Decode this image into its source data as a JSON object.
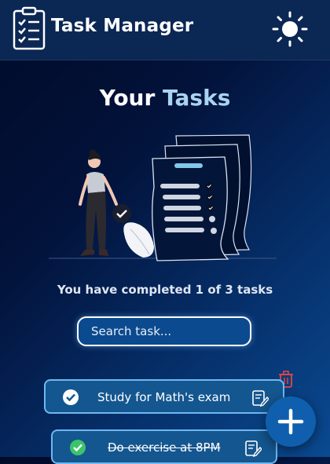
{
  "header": {
    "title": "Task Manager",
    "logo_icon": "checklist-clipboard-icon",
    "theme_toggle_icon": "sun-icon"
  },
  "main": {
    "heading_first": "Your",
    "heading_accent": "Tasks",
    "heading_accent_color": "#a9d4ef",
    "progress_text": "You have completed 1 of 3 tasks",
    "illustration": "woman-checking-checklist-illustration"
  },
  "search": {
    "placeholder": "Search task...",
    "value": ""
  },
  "tasks": [
    {
      "title": "Study for Math's exam",
      "completed": true,
      "strikethrough": false
    },
    {
      "title": "Do exercise at 8PM",
      "completed": true,
      "strikethrough": true
    }
  ],
  "actions": {
    "add_icon": "plus-icon",
    "delete_icon": "trash-icon",
    "edit_icon": "edit-note-icon"
  },
  "colors": {
    "header_bg": "#0b2754",
    "task_bg": "#14568f",
    "task_border": "#6fb8f0",
    "check_green": "#3bc46a",
    "delete_red": "#e24545"
  }
}
